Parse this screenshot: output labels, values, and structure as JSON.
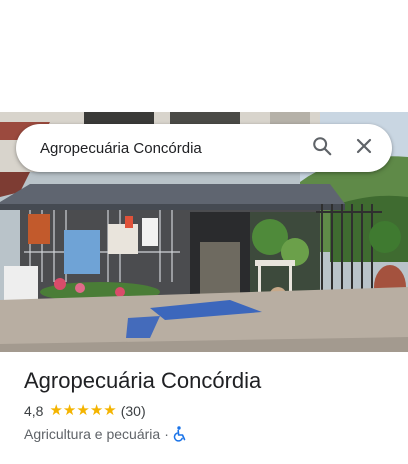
{
  "search": {
    "query": "Agropecuária Concórdia",
    "search_icon": "search-icon",
    "close_icon": "close-icon"
  },
  "place": {
    "name": "Agropecuária Concórdia",
    "rating": "4,8",
    "stars": 5,
    "review_count": "(30)",
    "category": "Agricultura e pecuária",
    "separator": "·",
    "accessibility_icon": "wheelchair-icon"
  },
  "colors": {
    "star": "#f4b400",
    "accessibility": "#1a73e8",
    "title": "#202124",
    "secondary": "#5f6368"
  }
}
